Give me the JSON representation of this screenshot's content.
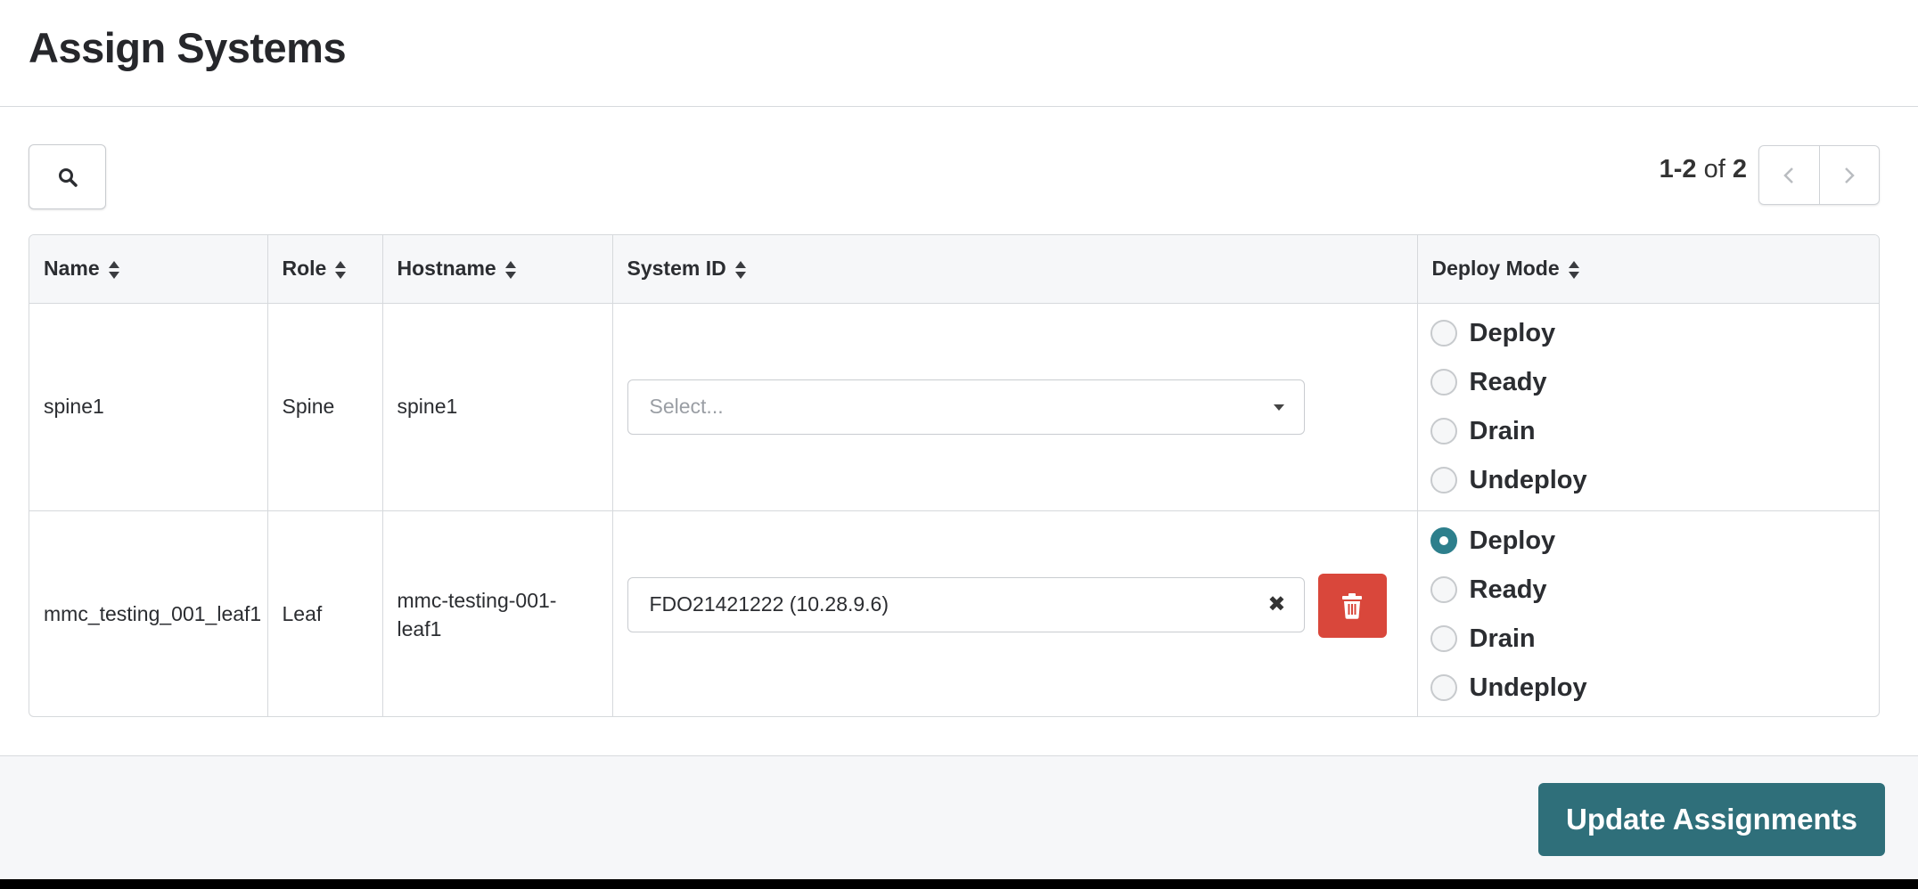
{
  "header": {
    "title": "Assign Systems"
  },
  "toolbar": {
    "search_icon": "search-icon",
    "pagination": {
      "range": "1-2",
      "of_label": "of",
      "total": "2"
    },
    "prev_icon": "chevron-left-icon",
    "next_icon": "chevron-right-icon"
  },
  "table": {
    "columns": [
      "Name",
      "Role",
      "Hostname",
      "System ID",
      "Deploy Mode"
    ],
    "rows": [
      {
        "name": "spine1",
        "role": "Spine",
        "hostname": "spine1",
        "system_id": {
          "value": "",
          "placeholder": "Select..."
        },
        "deploy_modes": [
          "Deploy",
          "Ready",
          "Drain",
          "Undeploy"
        ],
        "selected_mode": null
      },
      {
        "name": "mmc_testing_001_leaf1",
        "role": "Leaf",
        "hostname": "mmc-testing-001-leaf1",
        "system_id": {
          "value": "FDO21421222 (10.28.9.6)",
          "placeholder": "Select..."
        },
        "deploy_modes": [
          "Deploy",
          "Ready",
          "Drain",
          "Undeploy"
        ],
        "selected_mode": "Deploy"
      }
    ]
  },
  "footer": {
    "update_label": "Update Assignments"
  },
  "colors": {
    "accent": "#2f6f7a",
    "radio_checked": "#2d7f8c",
    "danger": "#d9473b"
  }
}
